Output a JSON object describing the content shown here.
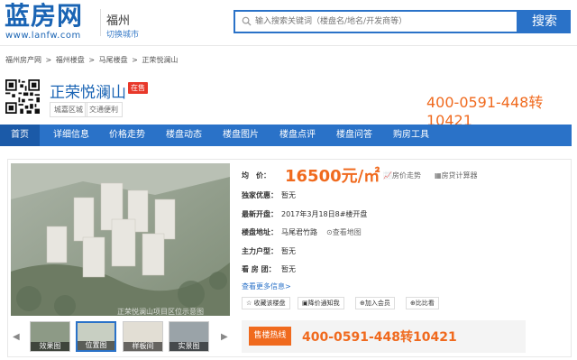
{
  "header": {
    "logo_text": "蓝房网",
    "logo_url_text": "www.lanfw.com",
    "city": "福州",
    "switch_city": "切换城市",
    "search_placeholder": "输入搜索关键词（楼盘名/地名/开发商等）",
    "search_button": "搜索"
  },
  "breadcrumb": [
    "福州房产网",
    ">",
    "福州楼盘",
    ">",
    "马尾楼盘",
    ">",
    "正荣悦澜山"
  ],
  "project": {
    "title": "正荣悦澜山",
    "status": "在售",
    "tags": [
      "城嘉区城",
      "交通便利"
    ],
    "hotline": "400-0591-448转10421"
  },
  "nav": [
    "首页",
    "详细信息",
    "价格走势",
    "楼盘动态",
    "楼盘图片",
    "楼盘点评",
    "楼盘问答",
    "购房工具"
  ],
  "details": {
    "price_label": "均　价：",
    "price_value": "16500元/㎡",
    "price_trend": "房价走势",
    "price_calc": "房贷计算器",
    "discount_label": "独家优惠：",
    "discount_value": "暂无",
    "open_label": "最新开盘：",
    "open_value": "2017年3月18日8#楼开盘",
    "address_label": "楼盘地址：",
    "address_value": "马尾君竹路",
    "map_link": "查看地图",
    "unit_label": "主力户型：",
    "unit_value": "暂无",
    "tour_label": "看 房 团：",
    "tour_value": "暂无",
    "more_info": "查看更多信息>",
    "actions": [
      "☆ 收藏该楼盘",
      "降价通知我",
      "加入会员",
      "比比看"
    ]
  },
  "photo": {
    "watermark": "正荣悦澜山项目区位示意图",
    "thumbs": [
      "效果图",
      "位置图",
      "样板间",
      "实景图"
    ]
  },
  "hotline_box": {
    "button": "售楼热线",
    "number": "400-0591-448转10421"
  },
  "colors": {
    "brand": "#2a72c8",
    "accent": "#f06a1e",
    "badge": "#e8382a"
  }
}
